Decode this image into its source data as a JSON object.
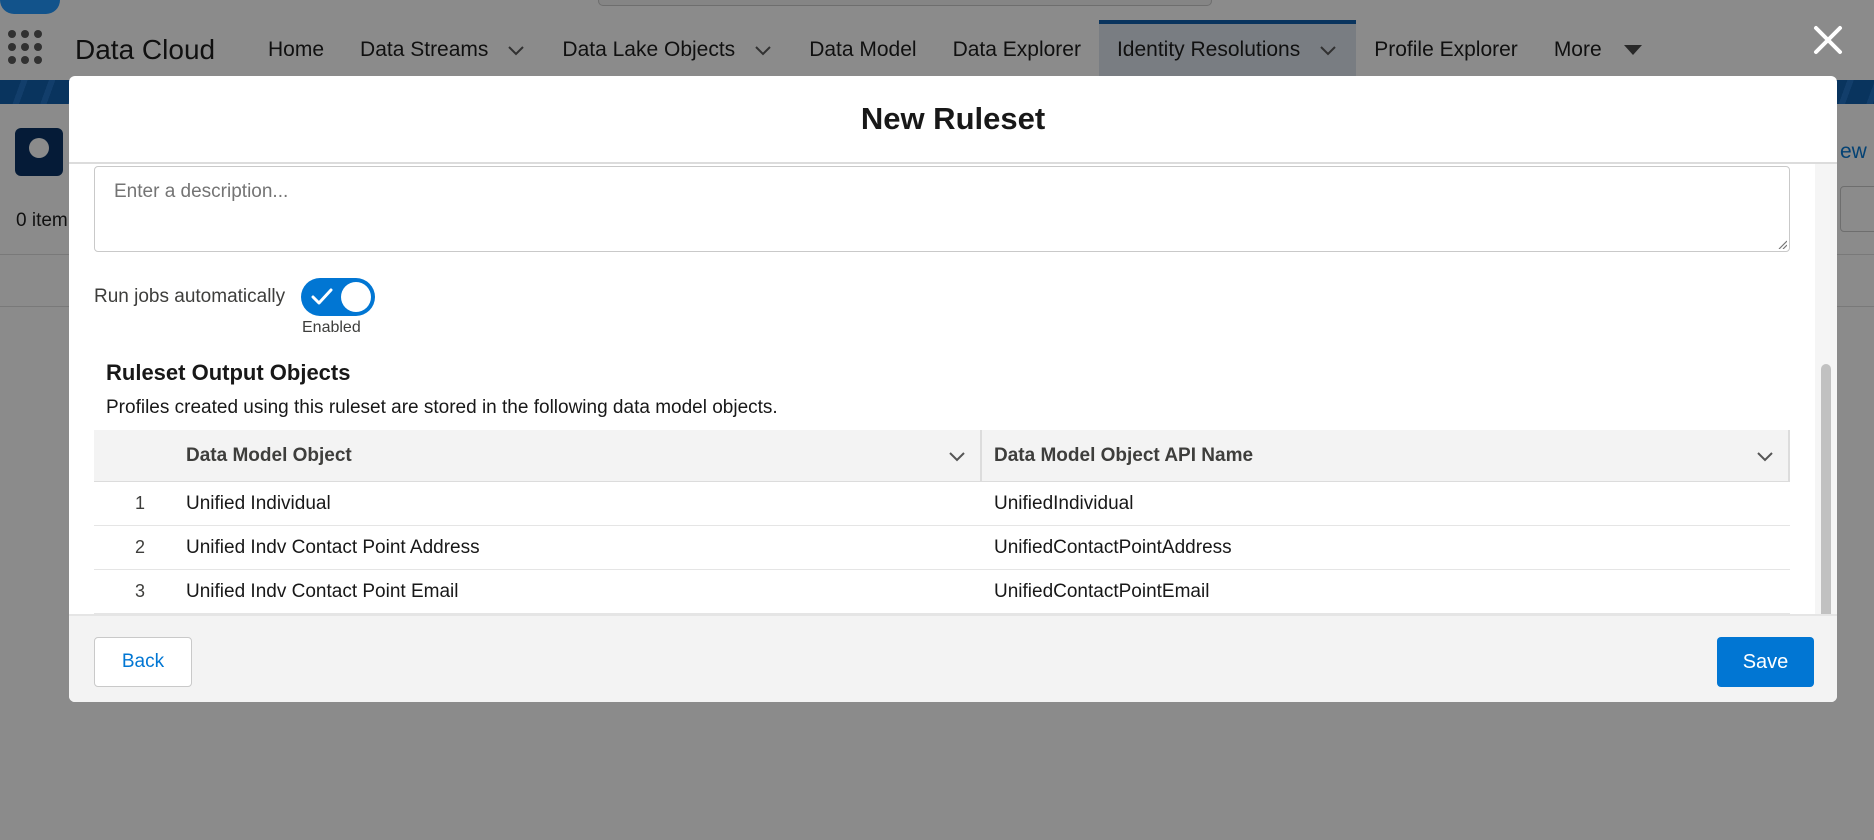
{
  "app": {
    "name": "Data Cloud",
    "nav": [
      {
        "label": "Home",
        "has_dropdown": false
      },
      {
        "label": "Data Streams",
        "has_dropdown": true
      },
      {
        "label": "Data Lake Objects",
        "has_dropdown": true
      },
      {
        "label": "Data Model",
        "has_dropdown": false
      },
      {
        "label": "Data Explorer",
        "has_dropdown": false
      },
      {
        "label": "Identity Resolutions",
        "has_dropdown": true,
        "active": true
      },
      {
        "label": "Profile Explorer",
        "has_dropdown": false
      },
      {
        "label": "More",
        "has_dropdown": true
      }
    ],
    "background": {
      "item_count": "0 item",
      "new_link": "ew"
    }
  },
  "modal": {
    "title": "New Ruleset",
    "description_placeholder": "Enter a description...",
    "toggle": {
      "label": "Run jobs automatically",
      "state": "Enabled",
      "on": true
    },
    "output_section": {
      "title": "Ruleset Output Objects",
      "description": "Profiles created using this ruleset are stored in the following data model objects.",
      "columns": [
        "Data Model Object",
        "Data Model Object API Name"
      ],
      "rows": [
        {
          "num": "1",
          "object": "Unified Individual",
          "api_name": "UnifiedIndividual"
        },
        {
          "num": "2",
          "object": "Unified Indv Contact Point Address",
          "api_name": "UnifiedContactPointAddress"
        },
        {
          "num": "3",
          "object": "Unified Indv Contact Point Email",
          "api_name": "UnifiedContactPointEmail"
        }
      ]
    },
    "footer": {
      "back_label": "Back",
      "save_label": "Save"
    }
  },
  "colors": {
    "brand": "#0176d3",
    "nav_active_bar": "#0b5cab",
    "backdrop": "rgba(8,8,8,0.47)"
  }
}
